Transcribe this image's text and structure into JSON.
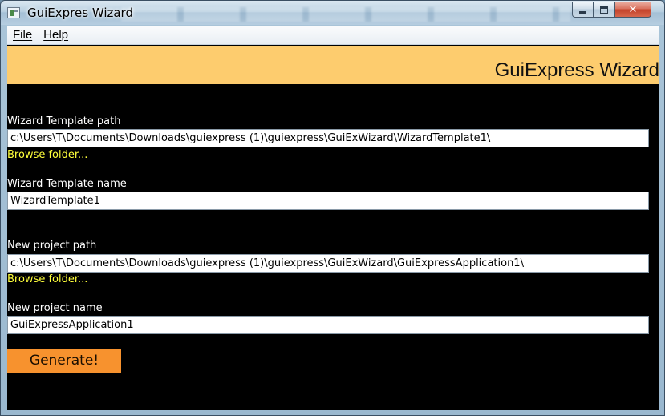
{
  "window": {
    "title": "GuiExpres Wizard",
    "controls": {
      "minimize": "minimize",
      "maximize": "maximize",
      "close": "✕"
    }
  },
  "menu": {
    "items": [
      {
        "label": "File"
      },
      {
        "label": "Help"
      }
    ]
  },
  "banner": {
    "title": "GuiExpress Wizard"
  },
  "form": {
    "template_path": {
      "label": "Wizard Template path",
      "value": "c:\\Users\\T\\Documents\\Downloads\\guiexpress (1)\\guiexpress\\GuiExWizard\\WizardTemplate1\\",
      "browse": "Browse folder..."
    },
    "template_name": {
      "label": "Wizard Template name",
      "value": "WizardTemplate1"
    },
    "project_path": {
      "label": "New project path",
      "value": "c:\\Users\\T\\Documents\\Downloads\\guiexpress (1)\\guiexpress\\GuiExWizard\\GuiExpressApplication1\\",
      "browse": "Browse folder..."
    },
    "project_name": {
      "label": "New project name",
      "value": "GuiExpressApplication1"
    },
    "generate_label": "Generate!"
  },
  "colors": {
    "banner": "#fdcc6e",
    "background": "#000000",
    "link": "#ffff3a",
    "button": "#f7922e"
  },
  "icons": {
    "app": "window-app-icon",
    "minimize": "minimize-icon",
    "maximize": "maximize-icon",
    "close": "close-icon"
  }
}
